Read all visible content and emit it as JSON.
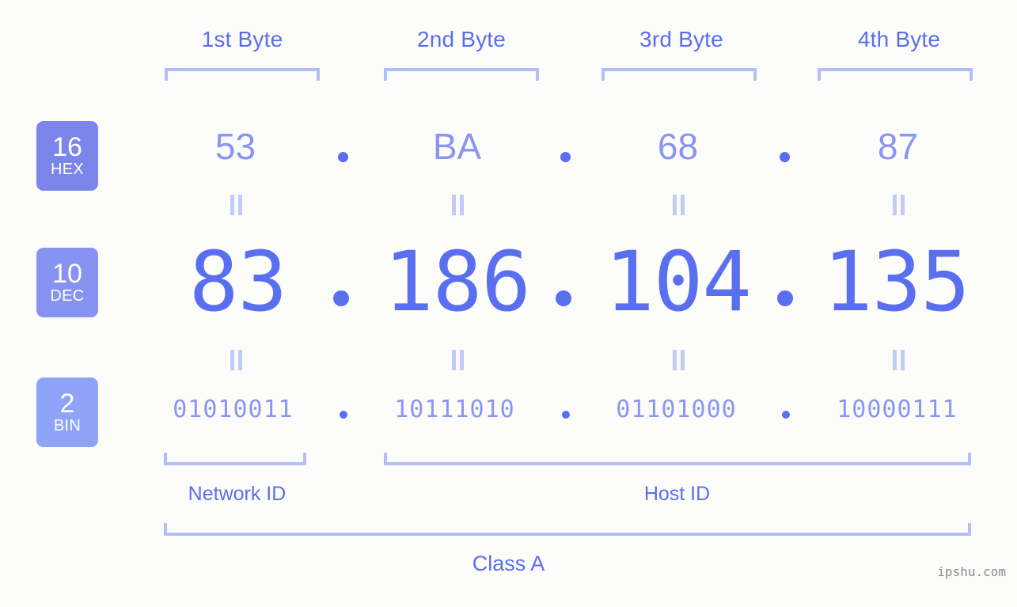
{
  "meta": {
    "background_color": "#fcfdfa",
    "accent_color": "#5a6ef0",
    "accent_light_color": "#8b95f1",
    "bracket_color": "#b3bdf7",
    "watermark": "ipshu.com"
  },
  "byte_headers": [
    {
      "label": "1st Byte"
    },
    {
      "label": "2nd Byte"
    },
    {
      "label": "3rd Byte"
    },
    {
      "label": "4th Byte"
    }
  ],
  "radix_badges": [
    {
      "number": "16",
      "base": "HEX",
      "color": "#7b85ea"
    },
    {
      "number": "10",
      "base": "DEC",
      "color": "#8793f0"
    },
    {
      "number": "2",
      "base": "BIN",
      "color": "#8fa4f8"
    }
  ],
  "rows": {
    "hex": {
      "values": [
        "53",
        "BA",
        "68",
        "87"
      ],
      "separator": "."
    },
    "dec": {
      "values": [
        "83",
        "186",
        "104",
        "135"
      ],
      "separator": "."
    },
    "bin": {
      "values": [
        "01010011",
        "10111010",
        "01101000",
        "10000111"
      ],
      "separator": "."
    }
  },
  "equivalence_marks": {
    "glyph": "||",
    "count_per_row": 4
  },
  "id_sections": [
    {
      "label": "Network ID"
    },
    {
      "label": "Host ID"
    }
  ],
  "class_label": "Class A",
  "ip_address": {
    "hex": "53.BA.68.87",
    "dec": "83.186.104.135",
    "bin": "01010011.10111010.01101000.10000111",
    "class": "Class A"
  }
}
